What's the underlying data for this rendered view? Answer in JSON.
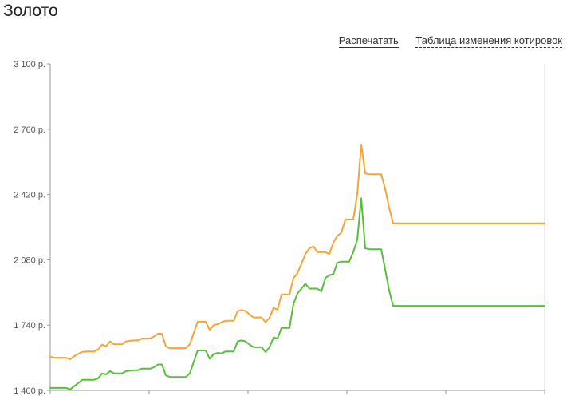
{
  "page": {
    "title": "Золото",
    "links": {
      "print": "Распечатать",
      "quotes_table": "Таблица изменения котировок"
    }
  },
  "colors": {
    "sell_line": "#f5a535",
    "buy_line": "#55c03a",
    "axis": "#999999",
    "text": "#555555"
  },
  "chart_data": {
    "type": "line",
    "title": "",
    "xlabel": "",
    "ylabel": "",
    "ylim": [
      1400,
      3100
    ],
    "y_ticks": [
      1400,
      1740,
      2080,
      2420,
      2760,
      3100
    ],
    "y_tick_labels": [
      "1 400 р.",
      "1 740 р.",
      "2 080 р.",
      "2 420 р.",
      "2 760 р.",
      "3 100 р."
    ],
    "x_gridlines": 5,
    "grid": false,
    "legend": "none",
    "x": [
      0,
      1,
      2,
      3,
      4,
      5,
      6,
      7,
      8,
      9,
      10,
      11,
      12,
      13,
      14,
      15,
      16,
      17,
      18,
      19,
      20,
      21,
      22,
      23,
      24,
      25,
      26,
      27,
      28,
      29,
      30,
      31,
      32,
      33,
      34,
      35,
      36,
      37,
      38,
      39,
      40,
      41,
      42,
      43,
      44,
      45,
      46,
      47,
      48,
      49,
      50,
      51,
      52,
      53,
      54,
      55,
      56,
      57,
      58,
      59,
      60,
      61,
      62,
      63,
      64,
      65,
      66,
      67,
      68,
      69,
      70,
      71,
      72,
      73,
      74,
      75,
      76,
      77,
      78,
      79,
      80,
      81,
      82,
      83,
      84,
      85,
      86,
      87,
      88,
      89,
      90,
      91,
      92,
      93,
      94,
      95,
      96,
      97,
      98,
      99,
      100,
      101,
      102,
      103,
      104,
      105,
      106,
      107,
      108,
      109,
      110,
      111,
      112,
      113,
      114,
      115,
      116,
      117,
      118,
      119,
      120,
      121,
      122,
      123,
      124
    ],
    "series": [
      {
        "color": "#f5a535",
        "values": [
          1575,
          1570,
          1570,
          1570,
          1570,
          1562,
          1578,
          1590,
          1600,
          1603,
          1603,
          1603,
          1613,
          1638,
          1630,
          1655,
          1640,
          1640,
          1640,
          1655,
          1658,
          1660,
          1660,
          1670,
          1670,
          1670,
          1680,
          1695,
          1695,
          1630,
          1620,
          1620,
          1620,
          1620,
          1620,
          1640,
          1700,
          1758,
          1758,
          1758,
          1715,
          1740,
          1745,
          1755,
          1763,
          1763,
          1763,
          1813,
          1818,
          1813,
          1795,
          1780,
          1780,
          1780,
          1755,
          1778,
          1830,
          1820,
          1900,
          1900,
          1900,
          1985,
          2010,
          2060,
          2110,
          2140,
          2150,
          2120,
          2120,
          2120,
          2110,
          2170,
          2205,
          2220,
          2290,
          2290,
          2290,
          2420,
          2680,
          2530,
          2525,
          2525,
          2525,
          2525,
          2450,
          2350,
          2270,
          2270,
          2270,
          2270,
          2270,
          2270,
          2270,
          2270,
          2270,
          2270,
          2270,
          2270,
          2270,
          2270,
          2270,
          2270,
          2270,
          2270,
          2270,
          2270,
          2270,
          2270,
          2270,
          2270,
          2270,
          2270,
          2270,
          2270,
          2270,
          2270,
          2270,
          2270,
          2270,
          2270,
          2270,
          2270,
          2270,
          2270,
          2270
        ]
      },
      {
        "color": "#55c03a",
        "values": [
          1413,
          1413,
          1413,
          1413,
          1413,
          1405,
          1422,
          1438,
          1455,
          1455,
          1455,
          1455,
          1463,
          1488,
          1483,
          1500,
          1488,
          1488,
          1488,
          1500,
          1503,
          1505,
          1505,
          1513,
          1513,
          1513,
          1520,
          1535,
          1535,
          1478,
          1470,
          1470,
          1470,
          1470,
          1470,
          1488,
          1550,
          1608,
          1608,
          1608,
          1565,
          1590,
          1595,
          1593,
          1603,
          1603,
          1603,
          1655,
          1660,
          1655,
          1638,
          1625,
          1625,
          1625,
          1600,
          1625,
          1675,
          1670,
          1725,
          1725,
          1725,
          1850,
          1905,
          1930,
          1955,
          1930,
          1930,
          1930,
          1915,
          1985,
          2000,
          2005,
          2065,
          2070,
          2070,
          2070,
          2120,
          2185,
          2400,
          2140,
          2135,
          2135,
          2135,
          2135,
          2030,
          1920,
          1840,
          1840,
          1840,
          1840,
          1840,
          1840,
          1840,
          1840,
          1840,
          1840,
          1840,
          1840,
          1840,
          1840,
          1840,
          1840,
          1840,
          1840,
          1840,
          1840,
          1840,
          1840,
          1840,
          1840,
          1840,
          1840,
          1840,
          1840,
          1840,
          1840,
          1840,
          1840,
          1840,
          1840,
          1840,
          1840,
          1840,
          1840,
          1840
        ]
      }
    ]
  }
}
